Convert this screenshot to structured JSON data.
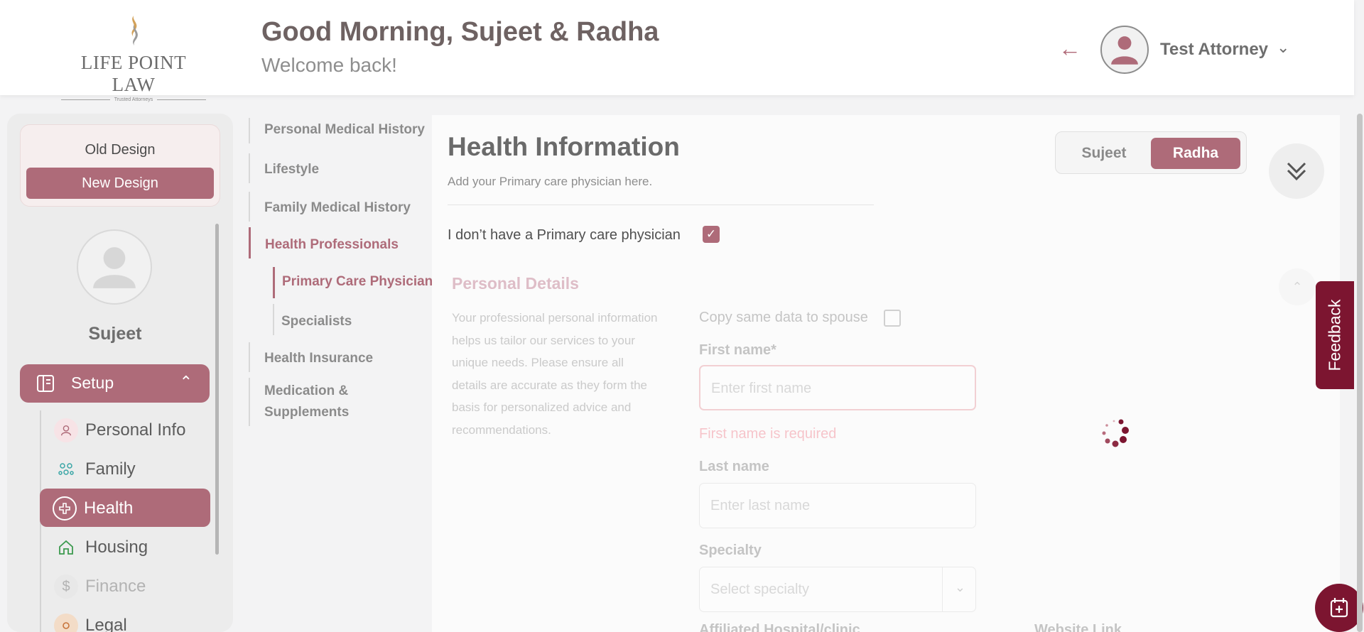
{
  "header": {
    "logo_name": "LIFE POINT LAW",
    "logo_tagline": "Trusted Attorneys",
    "greeting": "Good Morning, Sujeet & Radha",
    "welcome": "Welcome back!",
    "user_name": "Test Attorney"
  },
  "sidebar": {
    "old_design": "Old Design",
    "new_design": "New Design",
    "profile_name": "Sujeet",
    "setup_label": "Setup",
    "items": [
      {
        "label": "Personal Info",
        "icon": "person-icon"
      },
      {
        "label": "Family",
        "icon": "family-icon"
      },
      {
        "label": "Health",
        "icon": "health-plus-icon"
      },
      {
        "label": "Housing",
        "icon": "house-icon"
      },
      {
        "label": "Finance",
        "icon": "dollar-icon"
      },
      {
        "label": "Legal",
        "icon": "legal-icon"
      }
    ]
  },
  "subnav": {
    "items": [
      "Personal Medical History",
      "Lifestyle",
      "Family Medical History",
      "Health Professionals",
      "Primary Care Physician",
      "Specialists",
      "Health Insurance",
      "Medication &",
      "Supplements"
    ]
  },
  "main": {
    "title": "Health Information",
    "subtitle": "Add your Primary care physician here.",
    "toggle": [
      "Sujeet",
      "Radha"
    ],
    "no_pcp_label": "I don’t have a Primary care physician",
    "section_title": "Personal Details",
    "section_desc": "Your professional personal information helps us tailor our services to your unique needs. Please ensure all details are accurate as they form the basis for personalized advice and recommendations.",
    "copy_label": "Copy same data to spouse",
    "first_name_label": "First name*",
    "first_name_placeholder": "Enter first name",
    "first_name_error": "First name is required",
    "last_name_label": "Last name",
    "last_name_placeholder": "Enter last name",
    "specialty_label": "Specialty",
    "specialty_placeholder": "Select specialty",
    "affiliated_label": "Affiliated Hospital/clinic",
    "website_label": "Website Link"
  },
  "feedback_label": "Feedback",
  "colors": {
    "accent": "#ae6b79",
    "feedback_bg": "#7c1530",
    "error": "#f06c7c"
  }
}
